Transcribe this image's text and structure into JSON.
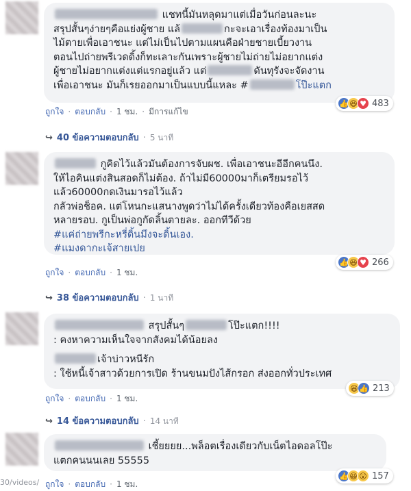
{
  "comments": [
    {
      "lines": [
        {
          "pre": "",
          "blur": 150,
          "post": " แชทนี้มันหลุดมาแต่เมื่อวันก่อนละนะ"
        },
        {
          "pre": "สรุปสั้นๆง่ายๆคือแย่งผู้ชาย แล้",
          "blur": 60,
          "post": "กะจะเอาเรื่องท้องมาเป็น"
        },
        {
          "pre": "ไม้ตายเพื่อเอาชนะ แต่ไม่เป็นไปตามแผนคือฝ่ายชายเบี้ยวงาน",
          "blur": 0,
          "post": ""
        },
        {
          "pre": "ตอนไปถ่ายพรีเวดดิ้งก็ทะเลาะกันเพราะผู้ชายไม่ถ่ายไม่อยากแต่ง",
          "blur": 0,
          "post": ""
        },
        {
          "pre": "ผู้ชายไม่อยากแต่งแต่แรกอยู่แล้ว แต่",
          "blur": 65,
          "post": "ดันทุรังจะจัดงาน"
        },
        {
          "pre": "เพื่อเอาชนะ มันก็เรยออกมาเป็นแบบนี้แหละ #",
          "blur": 65,
          "post": "โป๊ะแตก"
        }
      ],
      "meta": {
        "like": "ถูกใจ",
        "reply": "ตอบกลับ",
        "time": "1 ชม.",
        "edited": "มีการแก้ไข"
      },
      "reactions": {
        "icons": [
          "like-icon",
          "haha-icon",
          "love-icon"
        ],
        "count": "483"
      },
      "replies": {
        "label": "40 ข้อความตอบกลับ",
        "time": "5 นาที"
      }
    },
    {
      "lines": [
        {
          "pre": "",
          "blur": 60,
          "post": " กูคิดไว้แล้วมันต้องการจับผช. เพื่อเอาชนะอีอีกคนนึง."
        },
        {
          "pre": "ให้ไอคินแต่งสินสอดก็ไม่ต้อง. ถ้าไม่มี60000มาก็เตรียมรอไว้",
          "blur": 0,
          "post": ""
        },
        {
          "pre": "แล้ว60000กดเงินมารอไว้แล้ว",
          "blur": 0,
          "post": ""
        },
        {
          "pre": "กลัวพ่อช็อค. แต่โหนกะแสนางพูดว่าไม่ได้ครั้งเดียวท้องคือเยสสด",
          "blur": 0,
          "post": ""
        },
        {
          "pre": "หลายรอบ. กูเป็นพ่อกูกัดลิ้นตายละ. ออกทีวีด้วย",
          "blur": 0,
          "post": ""
        },
        {
          "pre": "#แค่ถ่ายพรีกะหรี่ดิ้นมึงจะดิ้นเอง.",
          "blur": 0,
          "post": "",
          "tag": true
        },
        {
          "pre": "#แมงดากะเจ้สายเปย",
          "blur": 0,
          "post": "",
          "tag": true
        }
      ],
      "meta": {
        "like": "ถูกใจ",
        "reply": "ตอบกลับ",
        "time": "1 ชม."
      },
      "reactions": {
        "icons": [
          "like-icon",
          "haha-icon",
          "love-icon"
        ],
        "count": "266"
      },
      "replies": {
        "label": "38 ข้อความตอบกลับ",
        "time": "1 นาที"
      }
    },
    {
      "lines": [
        {
          "pre": "",
          "blur": 130,
          "post": " สรุปสั้นๆ"
        },
        {
          "pre": ": คงหาความเห็นใจจากสังคมได้น้อยลง",
          "blur": 0,
          "post": ""
        },
        {
          "pre": "",
          "blur": 0,
          "post": ""
        },
        {
          "pre": "",
          "blur": 60,
          "post": "เจ้าบ่าวหนีรัก"
        },
        {
          "pre": ": ใช้หนี้เจ้าสาวด้วยการเปิด ร้านขนมปังไส้กรอก ส่งออกทั่วประเทศ",
          "blur": 0,
          "post": ""
        }
      ],
      "mid": "โป๊ะแตก!!!!",
      "meta": {
        "like": "ถูกใจ",
        "reply": "ตอบกลับ",
        "time": "1 ชม."
      },
      "reactions": {
        "icons": [
          "haha-icon",
          "like-icon"
        ],
        "count": "213"
      },
      "replies": {
        "label": "14 ข้อความตอบกลับ",
        "time": "14 นาที"
      }
    },
    {
      "lines": [
        {
          "pre": "",
          "blur": 130,
          "post": " เชี้ยยยย...พล็อตเรื่องเดียวกับเน็ตไอดอลโป๊ะ"
        },
        {
          "pre": "แตกคนนนเลย 55555",
          "blur": 0,
          "post": ""
        }
      ],
      "meta": {
        "like": "ถูกใจ",
        "reply": "ตอบกลับ",
        "time": "1 ชม."
      },
      "reactions": {
        "icons": [
          "like-icon",
          "haha-icon",
          "wow-icon"
        ],
        "count": "157"
      }
    }
  ],
  "footer_url": "30/videos/"
}
